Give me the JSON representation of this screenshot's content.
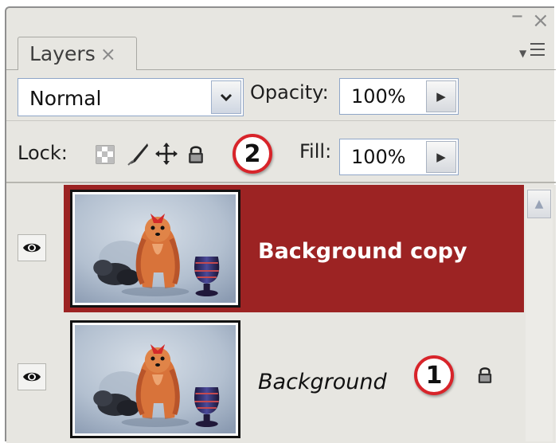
{
  "panel": {
    "tab_label": "Layers",
    "tab_close": "×",
    "minimize": "–",
    "close": "×"
  },
  "blend": {
    "mode": "Normal",
    "opacity_label": "Opacity:",
    "opacity_value": "100%"
  },
  "lock": {
    "label": "Lock:",
    "icons": [
      "lock-transparent-pixels-icon",
      "lock-image-pixels-icon",
      "lock-position-icon",
      "lock-all-icon"
    ],
    "fill_label": "Fill:",
    "fill_value": "100%"
  },
  "callouts": {
    "lock_callout": "2",
    "layer_lock_callout": "1"
  },
  "layers": [
    {
      "name": "Background copy",
      "visible": true,
      "selected": true,
      "locked": false
    },
    {
      "name": "Background",
      "visible": true,
      "selected": false,
      "locked": true
    }
  ],
  "colors": {
    "selection": "#9c2323",
    "callout_ring": "#d8242a",
    "panel_bg": "#e7e6e1"
  }
}
